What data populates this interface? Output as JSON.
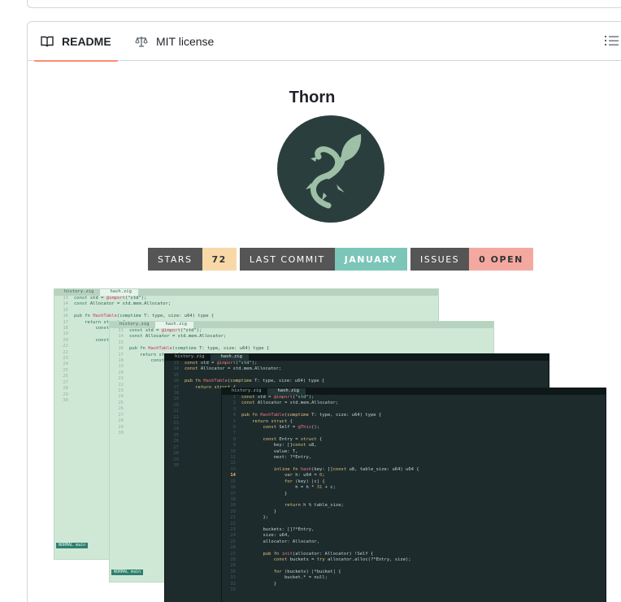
{
  "tabs": {
    "readme": "README",
    "license": "MIT license"
  },
  "readme": {
    "title": "Thorn",
    "badges": [
      {
        "label": "STARS",
        "value": "72"
      },
      {
        "label": "LAST COMMIT",
        "value": "JANUARY"
      },
      {
        "label": "ISSUES",
        "value": "0 OPEN"
      }
    ]
  },
  "editor": {
    "tab1": "history.zig",
    "tab2": "hash.zig",
    "mode_light": "NORMAL",
    "file_light": "main",
    "current_line": "14"
  },
  "colors": {
    "accent_underline": "#fd8c73",
    "logo_bg": "#2b3e3e",
    "logo_fg": "#9ec0a6"
  }
}
